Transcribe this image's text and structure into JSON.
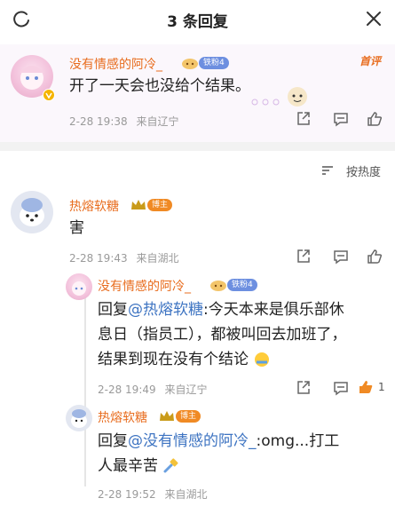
{
  "header": {
    "title": "3 条回复"
  },
  "top_comment": {
    "user": "没有情感的阿冷_",
    "fan_badge": "铁粉4",
    "follow_label": "首评",
    "text": "开了一天会也没给个结果。",
    "time": "2-28 19:38",
    "location": "来自辽宁"
  },
  "sort": {
    "label": "按热度"
  },
  "comments": [
    {
      "user": "热熔软糖",
      "badge": "博主",
      "text": "害",
      "time": "2-28 19:43",
      "location": "来自湖北"
    }
  ],
  "replies": [
    {
      "user": "没有情感的阿冷_",
      "fan_badge": "铁粉4",
      "reply_prefix": "回复",
      "mention": "@热熔软糖",
      "line1_rest": ":今天本来是俱乐部休",
      "line2": "息日（指员工），都被叫回去加班了，",
      "line3": "结果到现在没有个结论",
      "time": "2-28 19:49",
      "location": "来自辽宁",
      "likes": "1"
    },
    {
      "user": "热熔软糖",
      "badge": "博主",
      "reply_prefix": "回复",
      "mention": "@没有情感的阿冷_",
      "line1_rest": ":omg...打工",
      "line2": "人最辛苦",
      "time": "2-28 19:52",
      "location": "来自湖北"
    }
  ],
  "colors": {
    "name": "#e86d1f",
    "mention": "#3e74c2",
    "like_active": "#f08a24"
  }
}
